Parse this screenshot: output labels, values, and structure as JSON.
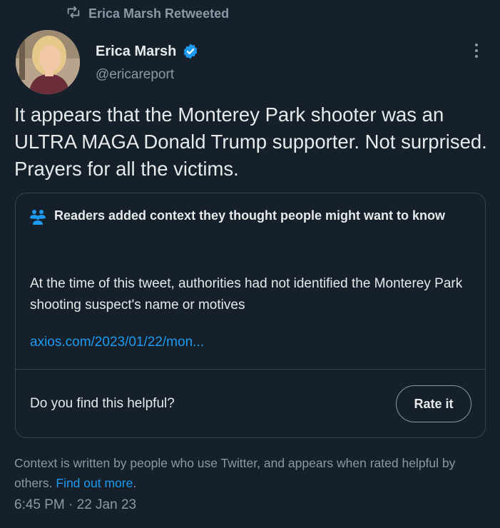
{
  "retweet": {
    "label": "Erica Marsh Retweeted",
    "icon": "retweet-icon"
  },
  "author": {
    "name": "Erica Marsh",
    "handle": "@ericareport",
    "verified_icon": "verified-badge-icon",
    "verified_color": "#1d9bf0"
  },
  "tweet": {
    "text": "It appears that the Monterey Park shooter was an ULTRA MAGA Donald Trump supporter. Not surprised. Prayers for all the victims."
  },
  "context_note": {
    "header_icon": "community-notes-icon",
    "header": "Readers added context they thought people might want to know",
    "body": "At the time of this tweet, authorities had not identified the Monterey Park shooting suspect's name or motives",
    "link": "axios.com/2023/01/22/mon...",
    "helpful_question": "Do you find this helpful?",
    "rate_button": "Rate it"
  },
  "footer": {
    "note": "Context is written by people who use Twitter, and appears when rated helpful by others.",
    "find_out_more": "Find out more",
    "note_end": ".",
    "timestamp": "6:45 PM · 22 Jan 23"
  },
  "colors": {
    "background": "#15202b",
    "text_primary": "#e7e9ea",
    "text_secondary": "#8b98a5",
    "link": "#1d9bf0",
    "border": "#38444d"
  }
}
